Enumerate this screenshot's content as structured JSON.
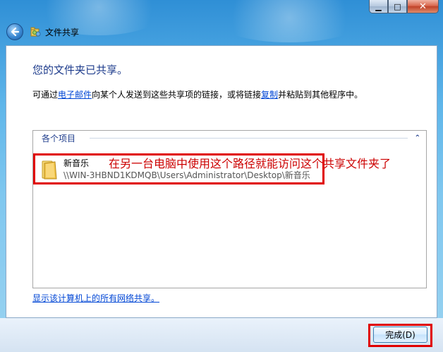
{
  "window": {
    "title": "文件共享",
    "caption": {
      "minimize": "▁",
      "maximize": "□",
      "close": "✕"
    }
  },
  "main": {
    "heading": "您的文件夹已共享。",
    "description": {
      "before_link1": "可通过",
      "link1": "电子邮件",
      "middle": "向某个人发送到这些共享项的链接，或将链接",
      "link2": "复制",
      "after_link2": "并粘贴到其他程序中。"
    },
    "items_panel": {
      "header": "各个项目",
      "items": [
        {
          "name": "新音乐",
          "path": "\\\\WIN-3HBND1KDMQB\\Users\\Administrator\\Desktop\\新音乐"
        }
      ]
    },
    "annotation": "在另一台电脑中使用这个路径就能访问这个共享文件夹了",
    "network_link": "显示该计算机上的所有网络共享。"
  },
  "footer": {
    "finish_button": "完成(D)"
  },
  "colors": {
    "accent": "#1e3c8c",
    "link": "#0046d5",
    "highlight": "#e00000",
    "annotation": "#cc0000"
  },
  "icons": {
    "back": "back-arrow-icon",
    "app": "file-share-icon",
    "folder": "folder-icon",
    "collapse": "chevron-up-icon"
  }
}
